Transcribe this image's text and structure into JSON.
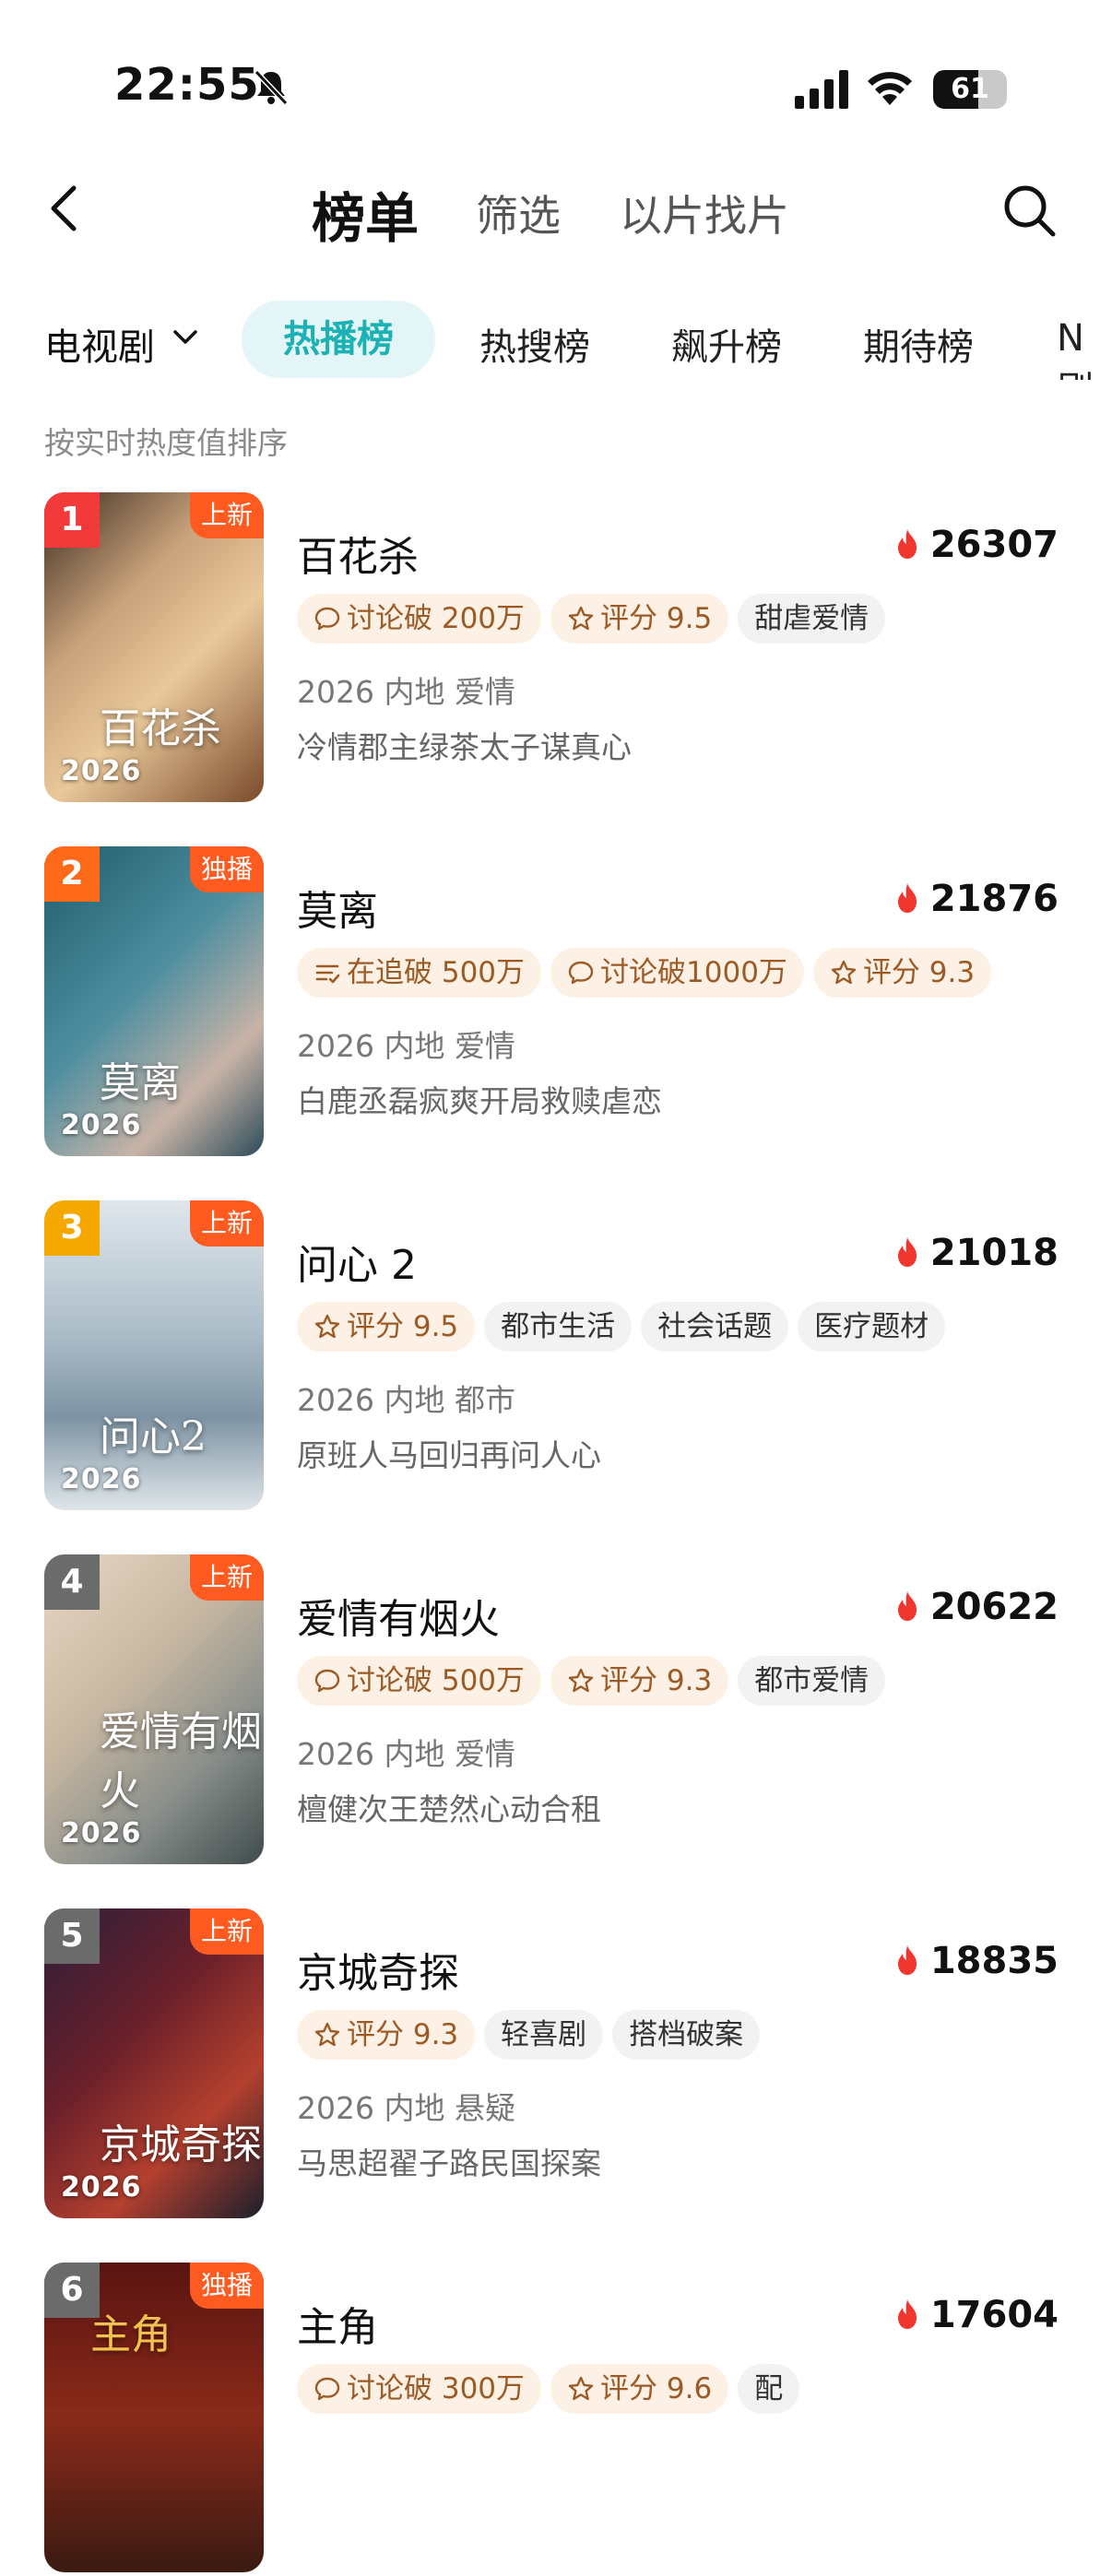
{
  "status": {
    "time": "22:55",
    "battery": "61",
    "battery_level": 0.61
  },
  "header": {
    "title": "榜单",
    "tab_filter": "筛选",
    "tab_find": "以片找片"
  },
  "categories": {
    "selected": "电视剧",
    "tabs": [
      "热播榜",
      "热搜榜",
      "飙升榜",
      "期待榜",
      "N刷"
    ]
  },
  "hint": "按实时热度值排序",
  "colors": {
    "accent": "#1cb1b4",
    "flame": "#f0362e"
  },
  "items": [
    {
      "rank": "1",
      "flag": "上新",
      "year": "2026",
      "poster_title": "百花杀",
      "title": "百花杀",
      "heat": "26307",
      "tags": [
        {
          "text": "讨论破 200万",
          "style": "orange",
          "icon": "comment-icon"
        },
        {
          "text": "评分 9.5",
          "style": "orange",
          "icon": "star-icon"
        },
        {
          "text": "甜虐爱情",
          "style": "gray",
          "icon": ""
        }
      ],
      "meta": "2026 内地 爱情",
      "desc": "冷情郡主绿茶太子谋真心"
    },
    {
      "rank": "2",
      "flag": "独播",
      "year": "2026",
      "poster_title": "莫离",
      "title": "莫离",
      "heat": "21876",
      "tags": [
        {
          "text": "在追破 500万",
          "style": "orange",
          "icon": "list-icon"
        },
        {
          "text": "讨论破1000万",
          "style": "orange",
          "icon": "comment-icon"
        },
        {
          "text": "评分 9.3",
          "style": "orange",
          "icon": "star-icon"
        }
      ],
      "meta": "2026 内地 爱情",
      "desc": "白鹿丞磊疯爽开局救赎虐恋"
    },
    {
      "rank": "3",
      "flag": "上新",
      "year": "2026",
      "poster_title": "问心2",
      "title": "问心 2",
      "heat": "21018",
      "tags": [
        {
          "text": "评分 9.5",
          "style": "orange",
          "icon": "star-icon"
        },
        {
          "text": "都市生活",
          "style": "gray",
          "icon": ""
        },
        {
          "text": "社会话题",
          "style": "gray",
          "icon": ""
        },
        {
          "text": "医疗题材",
          "style": "gray",
          "icon": ""
        }
      ],
      "meta": "2026 内地 都市",
      "desc": "原班人马回归再问人心"
    },
    {
      "rank": "4",
      "flag": "上新",
      "year": "2026",
      "poster_title": "爱情有烟火",
      "title": "爱情有烟火",
      "heat": "20622",
      "tags": [
        {
          "text": "讨论破 500万",
          "style": "orange",
          "icon": "comment-icon"
        },
        {
          "text": "评分 9.3",
          "style": "orange",
          "icon": "star-icon"
        },
        {
          "text": "都市爱情",
          "style": "gray",
          "icon": ""
        }
      ],
      "meta": "2026 内地 爱情",
      "desc": "檀健次王楚然心动合租"
    },
    {
      "rank": "5",
      "flag": "上新",
      "year": "2026",
      "poster_title": "京城奇探",
      "title": "京城奇探",
      "heat": "18835",
      "tags": [
        {
          "text": "评分 9.3",
          "style": "orange",
          "icon": "star-icon"
        },
        {
          "text": "轻喜剧",
          "style": "gray",
          "icon": ""
        },
        {
          "text": "搭档破案",
          "style": "gray",
          "icon": ""
        }
      ],
      "meta": "2026 内地 悬疑",
      "desc": "马思超翟子路民国探案"
    },
    {
      "rank": "6",
      "flag": "独播",
      "year": "",
      "poster_title": "主角",
      "title": "主角",
      "heat": "17604",
      "tags": [
        {
          "text": "讨论破 300万",
          "style": "orange",
          "icon": "comment-icon"
        },
        {
          "text": "评分 9.6",
          "style": "orange",
          "icon": "star-icon"
        },
        {
          "text": "配",
          "style": "gray",
          "icon": ""
        }
      ],
      "meta": "",
      "desc": ""
    }
  ]
}
